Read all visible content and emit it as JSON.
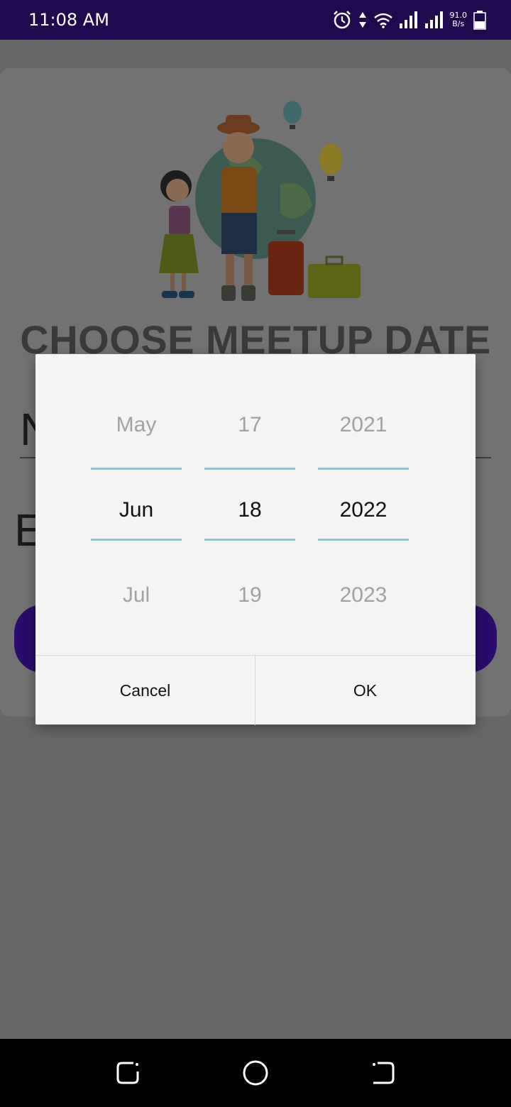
{
  "status_bar": {
    "time": "11:08 AM",
    "network_speed_value": "91.0",
    "network_speed_unit": "B/s",
    "icons": [
      "alarm-icon",
      "data-arrows-icon",
      "wifi-icon",
      "signal-icon",
      "signal-icon",
      "battery-icon"
    ]
  },
  "background": {
    "title": "CHOOSE MEETUP DATE",
    "field1_partial": "N",
    "field2_partial": "E",
    "accent_color": "#2b0b6b"
  },
  "date_picker": {
    "month": {
      "prev": "May",
      "selected": "Jun",
      "next": "Jul"
    },
    "day": {
      "prev": "17",
      "selected": "18",
      "next": "19"
    },
    "year": {
      "prev": "2021",
      "selected": "2022",
      "next": "2023"
    },
    "divider_color": "#7ec9dd",
    "cancel_label": "Cancel",
    "ok_label": "OK"
  },
  "nav_bar": {
    "icons": [
      "recents-icon",
      "home-icon",
      "back-icon"
    ]
  }
}
